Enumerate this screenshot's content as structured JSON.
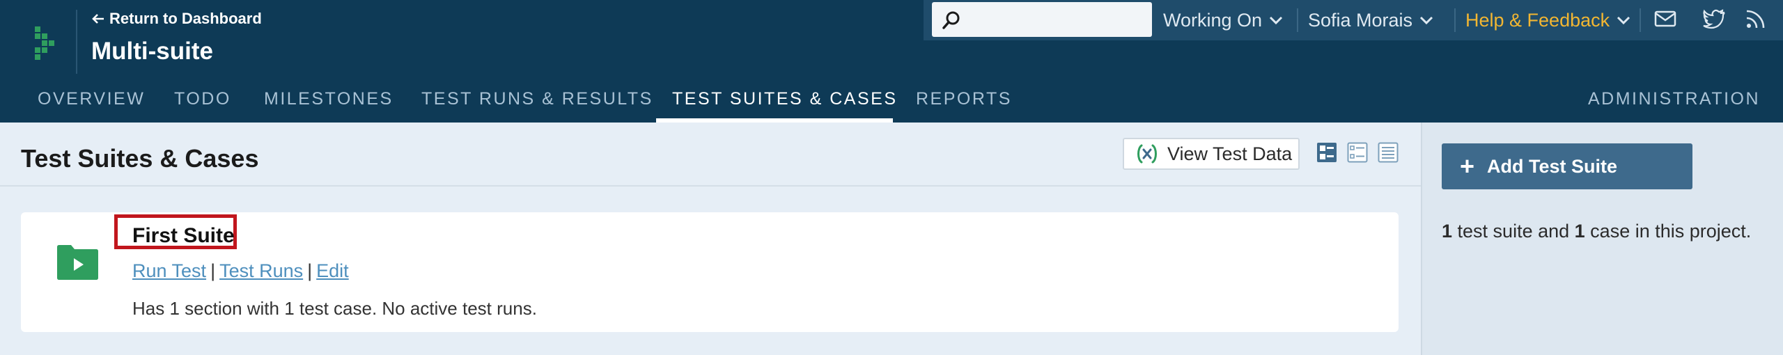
{
  "header": {
    "return_label": "Return to Dashboard",
    "project_title": "Multi-suite",
    "search_placeholder": "",
    "working_on_label": "Working On",
    "user_name": "Sofia Morais",
    "help_label": "Help & Feedback",
    "help_color": "#f2b632",
    "icons": [
      "mail-icon",
      "twitter-icon",
      "rss-icon"
    ]
  },
  "nav": {
    "tabs": [
      {
        "label": "OVERVIEW"
      },
      {
        "label": "TODO"
      },
      {
        "label": "MILESTONES"
      },
      {
        "label": "TEST RUNS & RESULTS"
      },
      {
        "label": "TEST SUITES & CASES",
        "active": true
      },
      {
        "label": "REPORTS"
      }
    ],
    "admin_label": "ADMINISTRATION"
  },
  "main": {
    "title": "Test Suites & Cases",
    "view_data_label": "View Test Data",
    "suite": {
      "name": "First Suite",
      "links": [
        "Run Test",
        "Test Runs",
        "Edit"
      ],
      "link_separator": "|",
      "description": "Has 1 section with 1 test case. No active test runs."
    }
  },
  "sidebar": {
    "add_button_label": "Add Test Suite",
    "summary": {
      "suite_count": "1",
      "suite_text": " test suite and ",
      "case_count": "1",
      "case_text": " case in this project."
    }
  },
  "colors": {
    "header_bg": "#0e3a56",
    "accent_green": "#2f9e5e",
    "highlight_red": "#c1161d",
    "link_blue": "#4e8fbd",
    "button_blue": "#3e6a8c"
  }
}
